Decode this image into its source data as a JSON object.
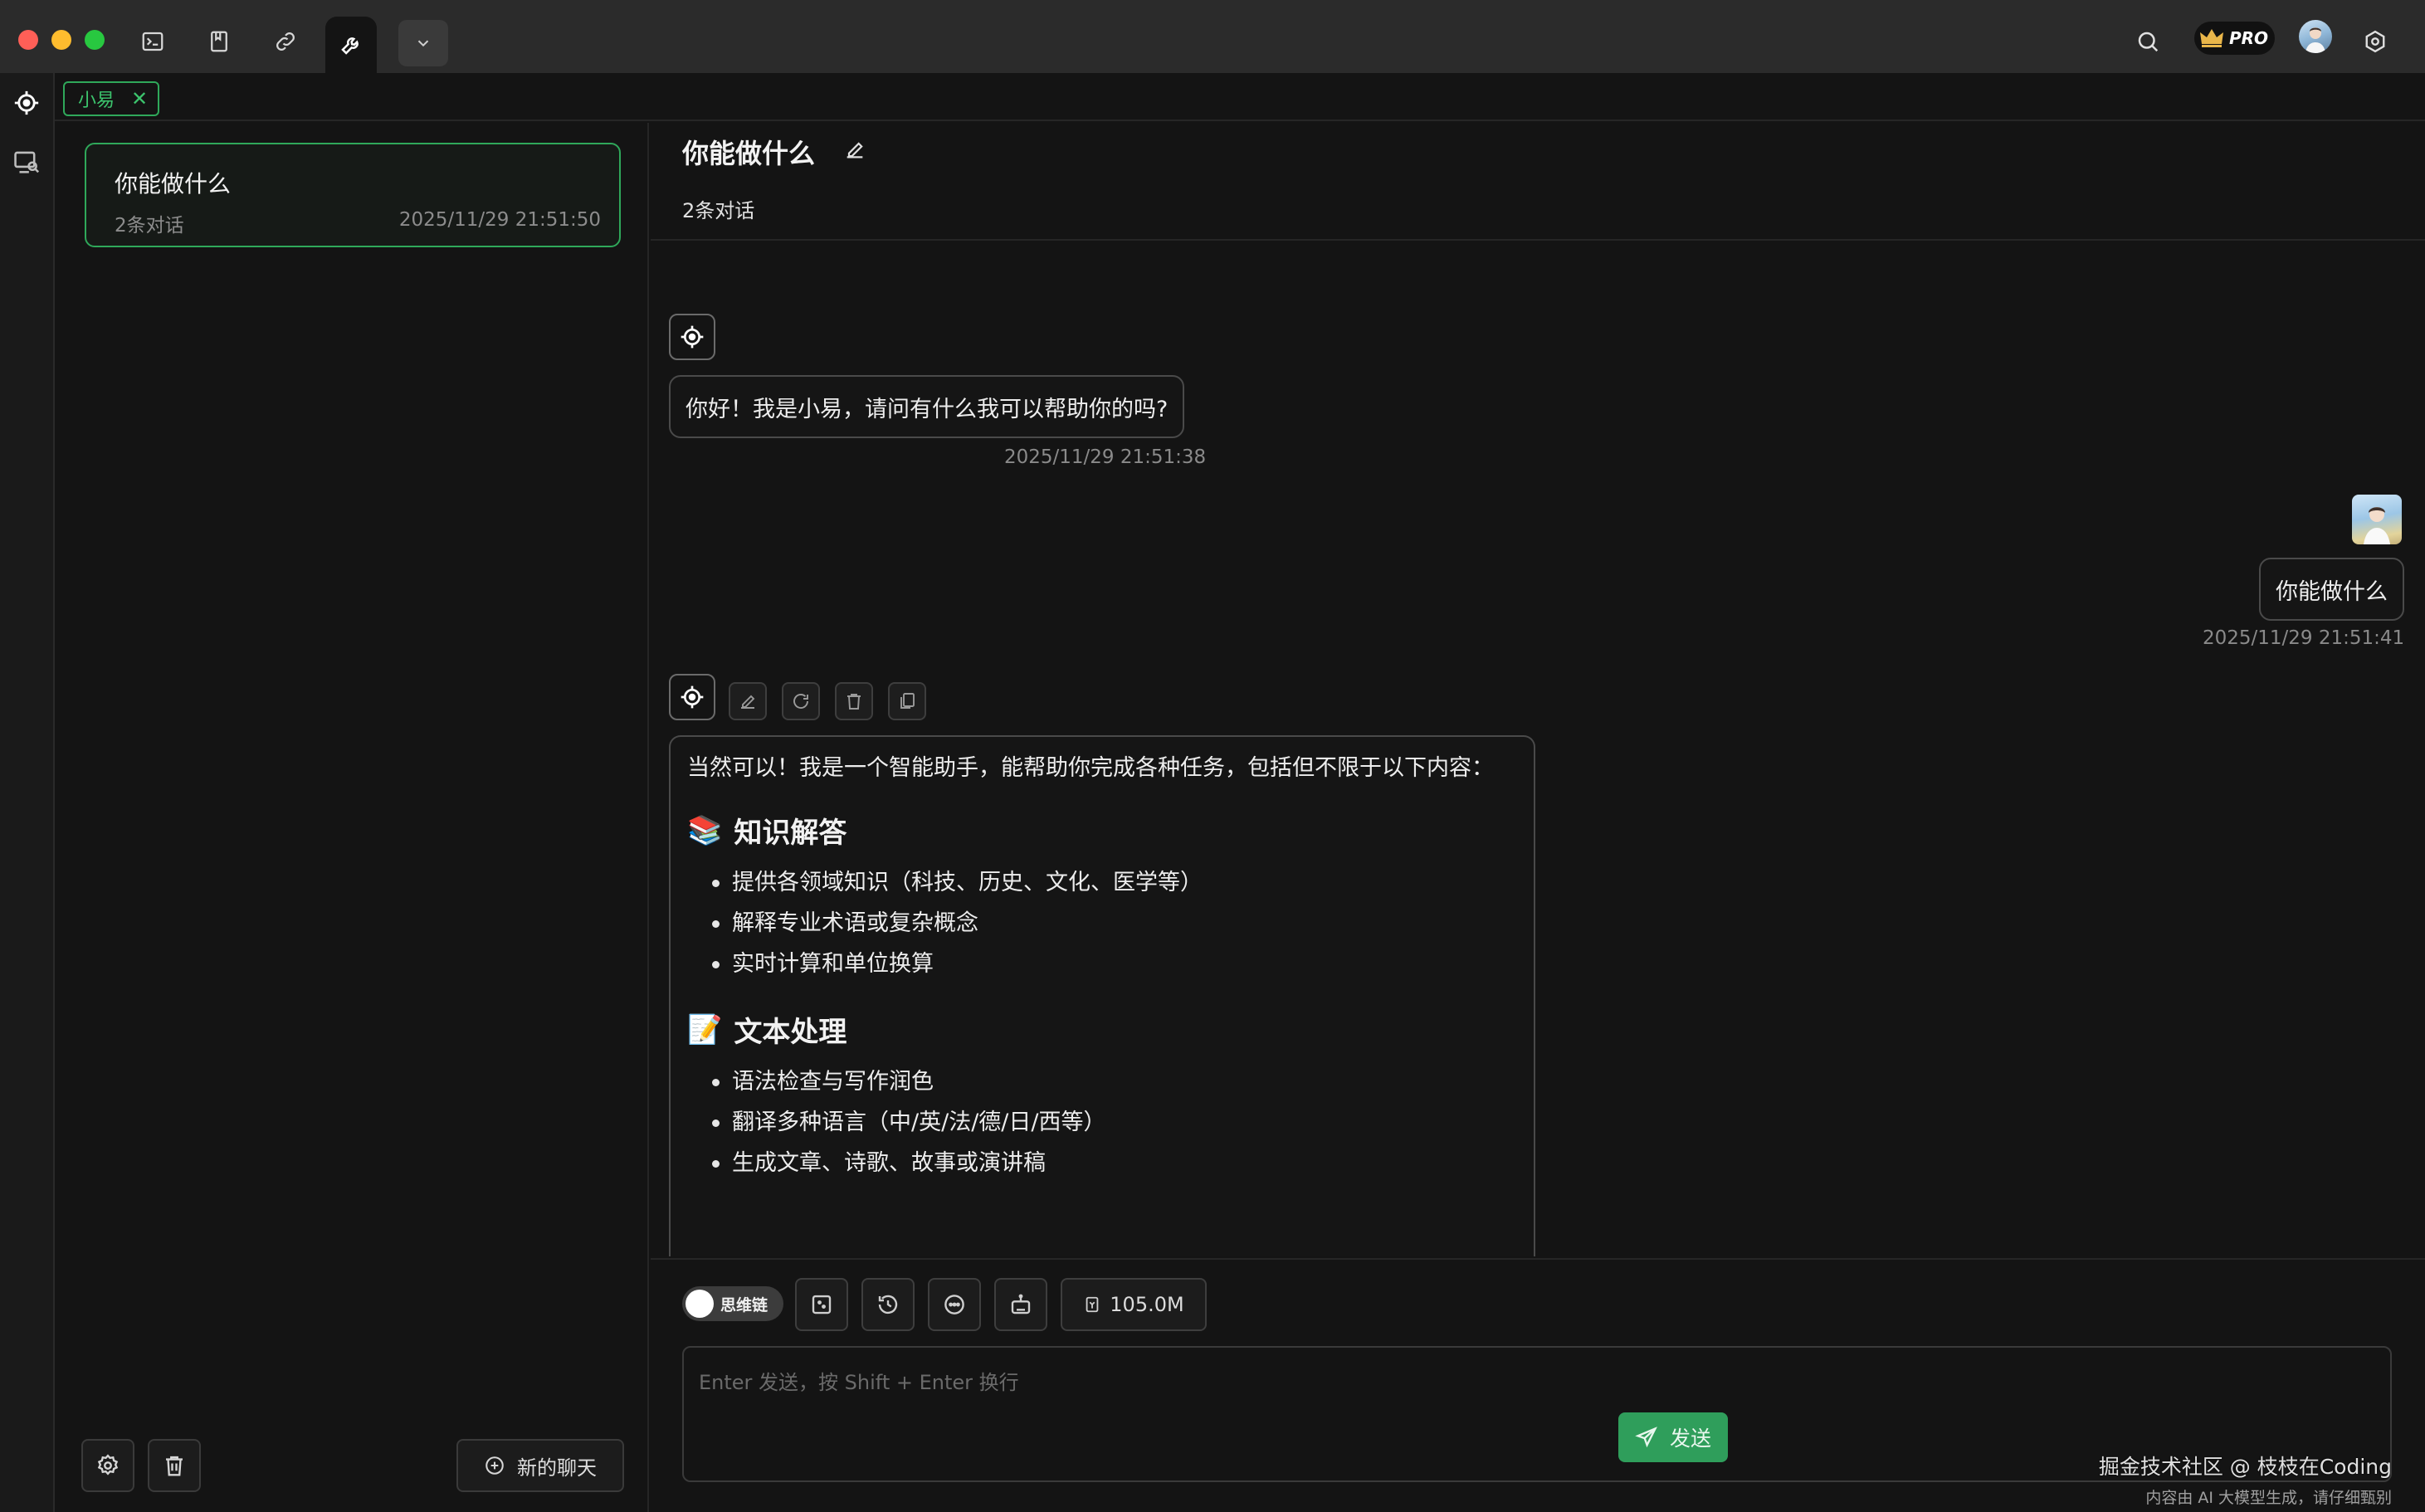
{
  "window": {
    "traffic_colors": [
      "#ff5f57",
      "#febc2e",
      "#28c840"
    ],
    "toolbar_icons": [
      "terminal-icon",
      "bookmark-icon",
      "link-icon",
      "wrench-icon",
      "chevron-down-icon"
    ],
    "right_icons": [
      "search-icon",
      "crown-icon",
      "settings-icon"
    ],
    "pro_label": "PRO"
  },
  "rail": {
    "icons": [
      "assistant-icon",
      "screen-search-icon"
    ]
  },
  "assistant_tag": {
    "label": "小易",
    "close": "✕",
    "accent": "#2fa85a"
  },
  "conversations": [
    {
      "title": "你能做什么",
      "count": "2条对话",
      "time": "2025/11/29 21:51:50"
    }
  ],
  "panel_footer": {
    "new_chat_label": "新的聊天"
  },
  "chat": {
    "title": "你能做什么",
    "subtitle": "2条对话",
    "messages": [
      {
        "role": "assistant",
        "text": "你好！我是小易，请问有什么我可以帮助你的吗?",
        "time": "2025/11/29 21:51:38"
      },
      {
        "role": "user",
        "text": "你能做什么",
        "time": "2025/11/29 21:51:41"
      },
      {
        "role": "assistant",
        "intro": "当然可以！我是一个智能助手，能帮助你完成各种任务，包括但不限于以下内容：",
        "sections": [
          {
            "emoji": "📚",
            "heading": "知识解答",
            "items": [
              "提供各领域知识（科技、历史、文化、医学等）",
              "解释专业术语或复杂概念",
              "实时计算和单位换算"
            ]
          },
          {
            "emoji": "📝",
            "heading": "文本处理",
            "items": [
              "语法检查与写作润色",
              "翻译多种语言（中/英/法/德/日/西等）",
              "生成文章、诗歌、故事或演讲稿"
            ]
          }
        ]
      }
    ]
  },
  "composer": {
    "think_label": "思维链",
    "model_size": "105.0M",
    "placeholder": "Enter 发送，按 Shift + Enter 换行",
    "send_label": "发送"
  },
  "watermark": {
    "main": "掘金技术社区 @ 枝枝在Coding",
    "sub": "内容由 AI 大模型生成，请仔细甄别"
  }
}
